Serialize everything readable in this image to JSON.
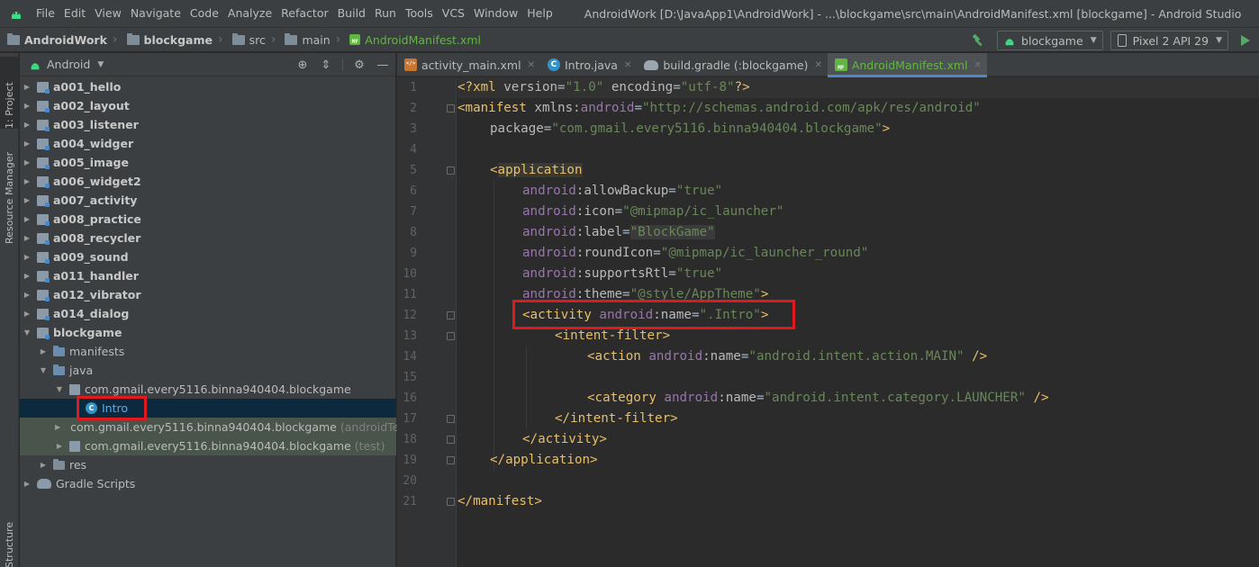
{
  "menubar": {
    "items": [
      "File",
      "Edit",
      "View",
      "Navigate",
      "Code",
      "Analyze",
      "Refactor",
      "Build",
      "Run",
      "Tools",
      "VCS",
      "Window",
      "Help"
    ],
    "window_title": "AndroidWork [D:\\JavaApp1\\AndroidWork] - ...\\blockgame\\src\\main\\AndroidManifest.xml [blockgame] - Android Studio"
  },
  "navbar": {
    "crumbs": [
      "AndroidWork",
      "blockgame",
      "src",
      "main",
      "AndroidManifest.xml"
    ],
    "run_config": "blockgame",
    "device": "Pixel 2 API 29"
  },
  "toolstrip": {
    "project_tab": "1: Project",
    "resource_tab": "Resource Manager",
    "structure_tab": "Structure"
  },
  "project": {
    "view_label": "Android",
    "tree": [
      {
        "label": "a001_hello"
      },
      {
        "label": "a002_layout"
      },
      {
        "label": "a003_listener"
      },
      {
        "label": "a004_widger"
      },
      {
        "label": "a005_image"
      },
      {
        "label": "a006_widget2"
      },
      {
        "label": "a007_activity"
      },
      {
        "label": "a008_practice"
      },
      {
        "label": "a008_recycler"
      },
      {
        "label": "a009_sound"
      },
      {
        "label": "a011_handler"
      },
      {
        "label": "a012_vibrator"
      },
      {
        "label": "a014_dialog"
      },
      {
        "label": "blockgame"
      },
      {
        "label": "manifests"
      },
      {
        "label": "java"
      },
      {
        "label": "com.gmail.every5116.binna940404.blockgame"
      },
      {
        "label": "Intro"
      },
      {
        "label": "com.gmail.every5116.binna940404.blockgame",
        "extra": "(androidTest)"
      },
      {
        "label": "com.gmail.every5116.binna940404.blockgame",
        "extra": "(test)"
      },
      {
        "label": "res"
      },
      {
        "label": "Gradle Scripts"
      }
    ]
  },
  "editor": {
    "tabs": [
      "activity_main.xml",
      "Intro.java",
      "build.gradle (:blockgame)",
      "AndroidManifest.xml"
    ],
    "line_numbers": [
      "1",
      "2",
      "3",
      "4",
      "5",
      "6",
      "7",
      "8",
      "9",
      "10",
      "11",
      "12",
      "13",
      "14",
      "15",
      "16",
      "17",
      "18",
      "19",
      "20",
      "21"
    ],
    "code": {
      "l1": [
        "<?xml ",
        "version",
        "=",
        "\"1.0\"",
        " ",
        "encoding",
        "=",
        "\"utf-8\"",
        "?>"
      ],
      "l2": [
        "<manifest ",
        "xmlns:",
        "android",
        "=",
        "\"http://schemas.android.com/apk/res/android\""
      ],
      "l3": [
        "package",
        "=",
        "\"com.gmail.every5116.binna940404.blockgame\"",
        ">"
      ],
      "l5": [
        "<",
        "application"
      ],
      "l6": [
        "android",
        ":allowBackup",
        "=",
        "\"true\""
      ],
      "l7": [
        "android",
        ":icon",
        "=",
        "\"@mipmap/ic_launcher\""
      ],
      "l8": [
        "android",
        ":label",
        "=",
        "\"BlockGame\""
      ],
      "l9": [
        "android",
        ":roundIcon",
        "=",
        "\"@mipmap/ic_launcher_round\""
      ],
      "l10": [
        "android",
        ":supportsRtl",
        "=",
        "\"true\""
      ],
      "l11": [
        "android",
        ":theme",
        "=",
        "\"@style/AppTheme\"",
        ">"
      ],
      "l12": [
        "<activity ",
        "android",
        ":name",
        "=",
        "\".Intro\"",
        ">"
      ],
      "l13": [
        "<intent-filter>"
      ],
      "l14": [
        "<action ",
        "android",
        ":name",
        "=",
        "\"android.intent.action.MAIN\"",
        " />"
      ],
      "l16": [
        "<category ",
        "android",
        ":name",
        "=",
        "\"android.intent.category.LAUNCHER\"",
        " />"
      ],
      "l17": [
        "</intent-filter>"
      ],
      "l18": [
        "</activity>"
      ],
      "l19": [
        "</application>"
      ],
      "l21": [
        "</manifest>"
      ]
    }
  },
  "colors": {
    "accent": "#4a88c7",
    "highlight_box": "#e0191e",
    "xml_tag": "#e8bf6a",
    "xml_string": "#6a8759",
    "xml_namespace": "#9876aa"
  }
}
